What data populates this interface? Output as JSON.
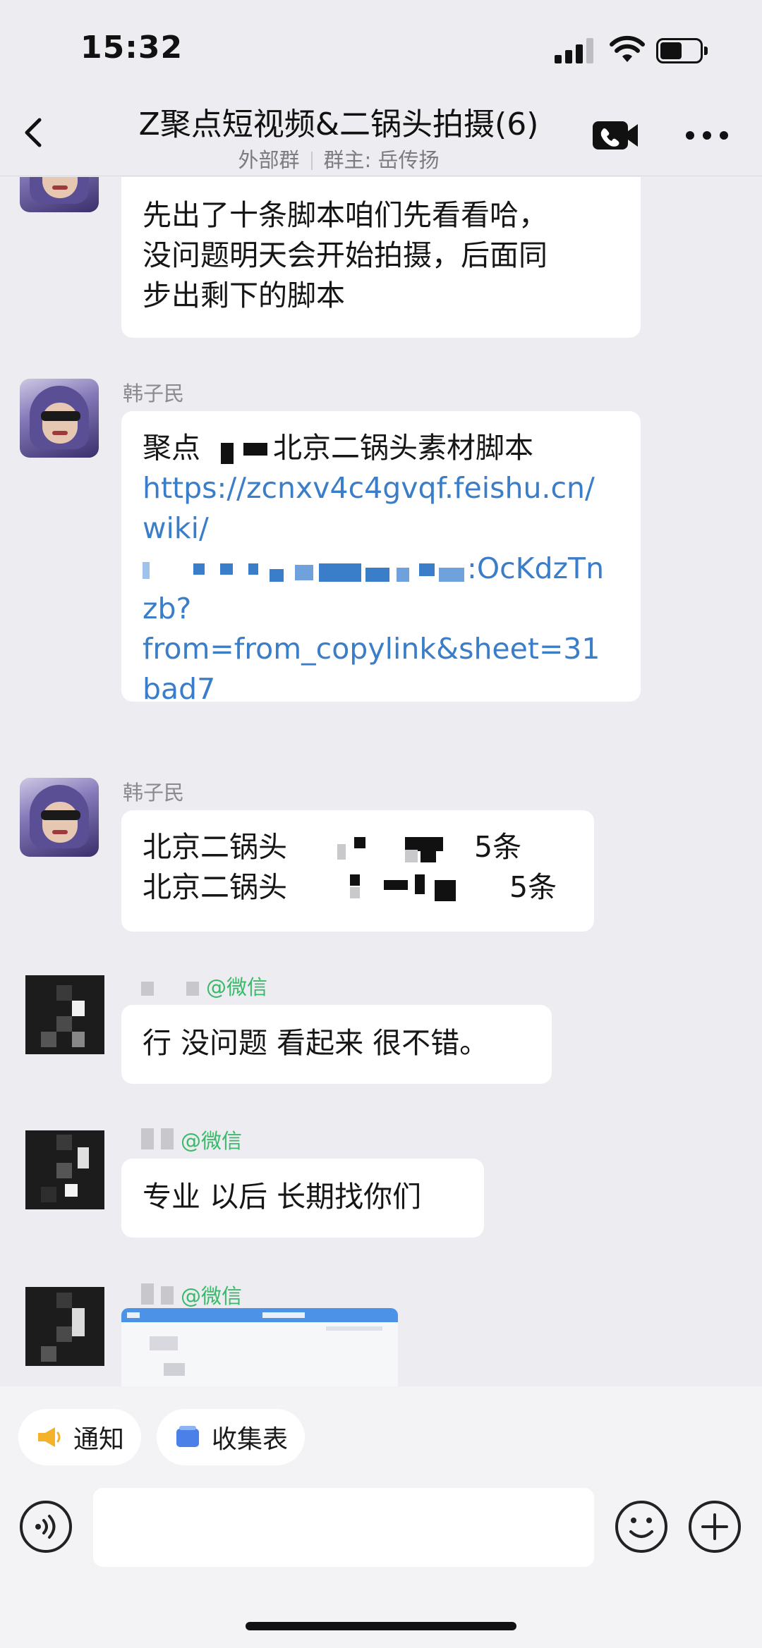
{
  "status_bar": {
    "time": "15:32"
  },
  "header": {
    "title": "Z聚点短视频&二锅头拍摄(6)",
    "group_type": "外部群",
    "owner": "群主: 岳传扬"
  },
  "messages": [
    {
      "text_lines": [
        "先出了十条脚本咱们先看看哈，",
        "没问题明天会开始拍摄，后面同",
        "步出剩下的脚本"
      ]
    },
    {
      "sender": "韩子民",
      "prefix": "聚点",
      "title_tail": "北京二锅头素材脚本",
      "link_line1": "https://zcnxv4c4gvqf.feishu.cn/",
      "link_line2": "wiki/",
      "link_line3_tail": ":OcKdzTn",
      "link_line4": "zb?",
      "link_line5": "from=from_copylink&sheet=31",
      "link_line6": "bad7"
    },
    {
      "sender": "韩子民",
      "row1_label": "北京二锅头",
      "row1_count": "5条",
      "row2_label": "北京二锅头",
      "row2_count": "5条"
    },
    {
      "source": "@微信",
      "text": "行 没问题 看起来 很不错。"
    },
    {
      "source": "@微信",
      "text": "专业 以后 长期找你们"
    },
    {
      "source": "@微信"
    }
  ],
  "quick_actions": [
    {
      "label": "通知",
      "icon": "megaphone-icon"
    },
    {
      "label": "收集表",
      "icon": "form-icon"
    }
  ],
  "colors": {
    "link": "#3a7dc8",
    "wechat": "#3bb96a",
    "background": "#ececf1"
  }
}
